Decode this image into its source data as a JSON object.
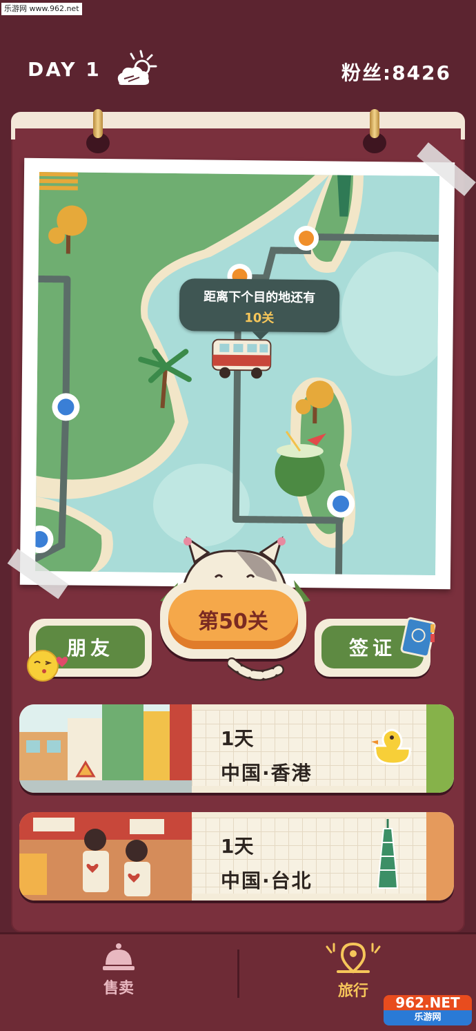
{
  "watermark": {
    "top": "乐游网 www.962.net",
    "brand": "962.NET",
    "sub": "乐游网"
  },
  "hud": {
    "day_label": "DAY 1",
    "weather_icon": "sun-cloud-icon",
    "fans_label": "粉丝:",
    "fans_value": "8426"
  },
  "map": {
    "tooltip_line1": "距离下个目的地还有",
    "tooltip_line2": "10关"
  },
  "buttons": {
    "friends": "朋友",
    "visa": "签证",
    "level": "第50关"
  },
  "trips": [
    {
      "days": "1天",
      "place": "中国·香港",
      "icon": "rubber-duck-icon",
      "tab_color": "#86b24a"
    },
    {
      "days": "1天",
      "place": "中国·台北",
      "icon": "taipei101-icon",
      "tab_color": "#e59a5c"
    }
  ],
  "nav": {
    "sell": "售卖",
    "travel": "旅行"
  },
  "colors": {
    "background": "#5c2430",
    "board": "#7a303d",
    "accent_orange": "#f5a84a",
    "accent_green": "#5e8a42"
  }
}
